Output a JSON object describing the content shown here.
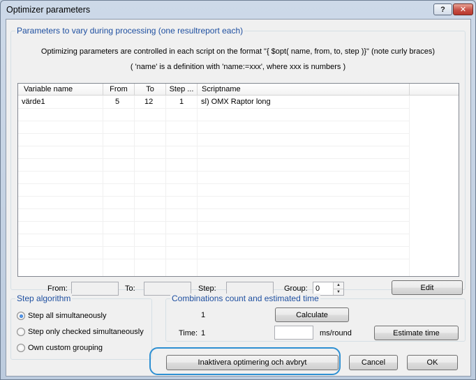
{
  "window": {
    "title": "Optimizer parameters",
    "help_label": "?",
    "close_label": "✕"
  },
  "params_group": {
    "legend": "Parameters to vary during processing (one resultreport each)",
    "info_line1": "Optimizing parameters are controlled in each script on the format \"{ $opt( name, from, to, step )}\" (note curly braces)",
    "info_line2": "( 'name' is a definition with 'name:=xxx', where xxx is numbers )"
  },
  "table": {
    "columns": [
      "Variable name",
      "From",
      "To",
      "Step ...",
      "Scriptname"
    ],
    "rows": [
      {
        "variable": "värde1",
        "from": "5",
        "to": "12",
        "step": "1",
        "script": "sl) OMX Raptor long"
      }
    ]
  },
  "edit_row": {
    "from_label": "From:",
    "from_value": "",
    "to_label": "To:",
    "to_value": "",
    "step_label": "Step:",
    "step_value": "",
    "group_label": "Group:",
    "group_value": "0",
    "edit_button": "Edit"
  },
  "step_algorithm": {
    "legend": "Step algorithm",
    "options": [
      {
        "label": "Step all simultaneously",
        "selected": true
      },
      {
        "label": "Step only checked simultaneously",
        "selected": false
      },
      {
        "label": "Own custom grouping",
        "selected": false
      }
    ]
  },
  "combinations": {
    "legend": "Combinations count and estimated time",
    "count": "1",
    "calculate_button": "Calculate",
    "time_label": "Time:",
    "time_value": "1",
    "ms_value": "",
    "ms_unit": "ms/round",
    "estimate_button": "Estimate time"
  },
  "footer": {
    "inactivate_button": "Inaktivera optimering och avbryt",
    "cancel_button": "Cancel",
    "ok_button": "OK",
    "highlight_color": "#2d8fd2"
  }
}
